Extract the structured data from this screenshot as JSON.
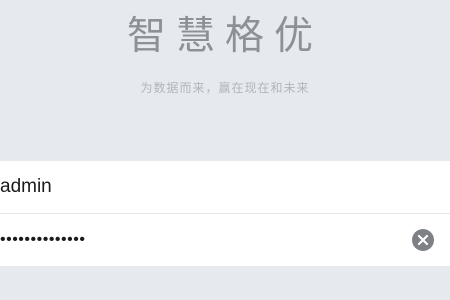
{
  "header": {
    "app_title": "智慧格优",
    "slogan": "为数据而来，赢在现在和未来"
  },
  "login_form": {
    "username": {
      "value": "admin"
    },
    "password": {
      "value": "••••••••••••••"
    },
    "clear_icon": "clear-circle-x-icon"
  }
}
